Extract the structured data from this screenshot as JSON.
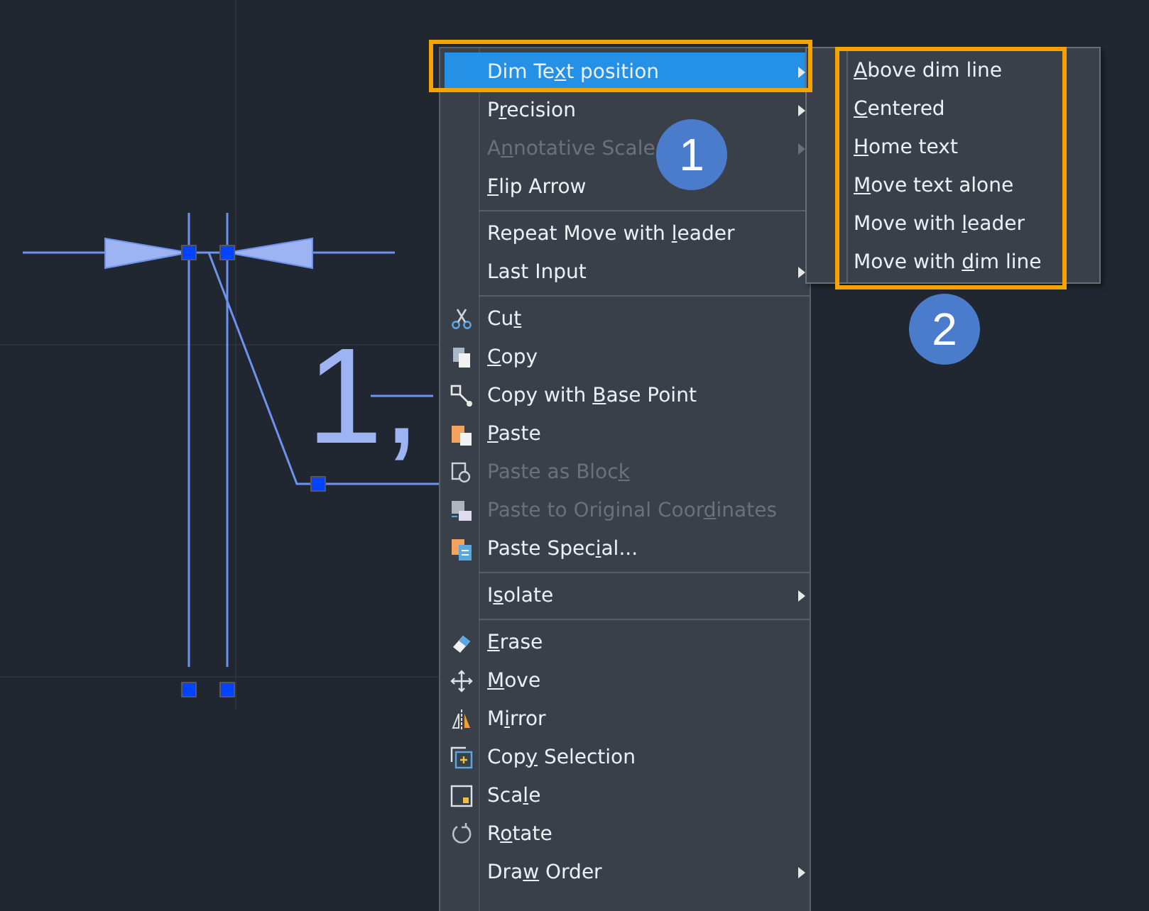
{
  "drawing": {
    "dimension_text": "1,"
  },
  "context_menu": {
    "sections": [
      {
        "items": [
          {
            "label": {
              "before": "Dim Te",
              "key": "x",
              "after": "t position"
            },
            "submenu": true,
            "disabled": false,
            "selected": true
          },
          {
            "label": {
              "before": "P",
              "key": "r",
              "after": "ecision"
            },
            "submenu": true,
            "disabled": false,
            "selected": false
          },
          {
            "label": {
              "before": "A",
              "key": "n",
              "after": "notative Scale"
            },
            "submenu": true,
            "disabled": true,
            "selected": false
          },
          {
            "label": {
              "key": "F",
              "after": "lip Arrow"
            },
            "submenu": false,
            "disabled": false,
            "selected": false
          }
        ]
      },
      {
        "items": [
          {
            "label": {
              "before": "Repeat Move with ",
              "key": "l",
              "after": "eader"
            },
            "submenu": false,
            "disabled": false,
            "selected": false
          },
          {
            "label": {
              "before": "Last Input"
            },
            "submenu": true,
            "disabled": false,
            "selected": false
          }
        ]
      },
      {
        "items": [
          {
            "label": {
              "before": "Cu",
              "key": "t"
            },
            "submenu": false,
            "disabled": false,
            "selected": false
          },
          {
            "label": {
              "key": "C",
              "after": "opy"
            },
            "submenu": false,
            "disabled": false,
            "selected": false
          },
          {
            "label": {
              "before": "Copy with ",
              "key": "B",
              "after": "ase Point"
            },
            "submenu": false,
            "disabled": false,
            "selected": false
          },
          {
            "label": {
              "key": "P",
              "after": "aste"
            },
            "submenu": false,
            "disabled": false,
            "selected": false
          },
          {
            "label": {
              "before": "Paste as Bloc",
              "key": "k"
            },
            "submenu": false,
            "disabled": true,
            "selected": false
          },
          {
            "label": {
              "before": "Paste to Original Coor",
              "key": "d",
              "after": "inates"
            },
            "submenu": false,
            "disabled": true,
            "selected": false
          },
          {
            "label": {
              "before": "Paste Spec",
              "key": "i",
              "after": "al..."
            },
            "submenu": false,
            "disabled": false,
            "selected": false
          }
        ]
      },
      {
        "items": [
          {
            "label": {
              "before": "I",
              "key": "s",
              "after": "olate"
            },
            "submenu": true,
            "disabled": false,
            "selected": false
          }
        ]
      },
      {
        "items": [
          {
            "label": {
              "key": "E",
              "after": "rase"
            },
            "submenu": false,
            "disabled": false,
            "selected": false
          },
          {
            "label": {
              "key": "M",
              "after": "ove"
            },
            "submenu": false,
            "disabled": false,
            "selected": false
          },
          {
            "label": {
              "before": "M",
              "key": "i",
              "after": "rror"
            },
            "submenu": false,
            "disabled": false,
            "selected": false
          },
          {
            "label": {
              "before": "Cop",
              "key": "y",
              "after": " Selection"
            },
            "submenu": false,
            "disabled": false,
            "selected": false
          },
          {
            "label": {
              "before": "Sca",
              "key": "l",
              "after": "e"
            },
            "submenu": false,
            "disabled": false,
            "selected": false
          },
          {
            "label": {
              "before": "R",
              "key": "o",
              "after": "tate"
            },
            "submenu": false,
            "disabled": false,
            "selected": false
          },
          {
            "label": {
              "before": "Dra",
              "key": "w",
              "after": " Order"
            },
            "submenu": true,
            "disabled": false,
            "selected": false
          }
        ]
      }
    ]
  },
  "submenu": {
    "items": [
      {
        "label": {
          "key": "A",
          "after": "bove dim line"
        }
      },
      {
        "label": {
          "key": "C",
          "after": "entered"
        }
      },
      {
        "label": {
          "key": "H",
          "after": "ome text"
        }
      },
      {
        "label": {
          "key": "M",
          "after": "ove text alone"
        }
      },
      {
        "label": {
          "before": "Move with ",
          "key": "l",
          "after": "eader"
        }
      },
      {
        "label": {
          "before": "Move with ",
          "key": "d",
          "after": "im line"
        }
      }
    ]
  },
  "callouts": [
    "1",
    "2"
  ]
}
